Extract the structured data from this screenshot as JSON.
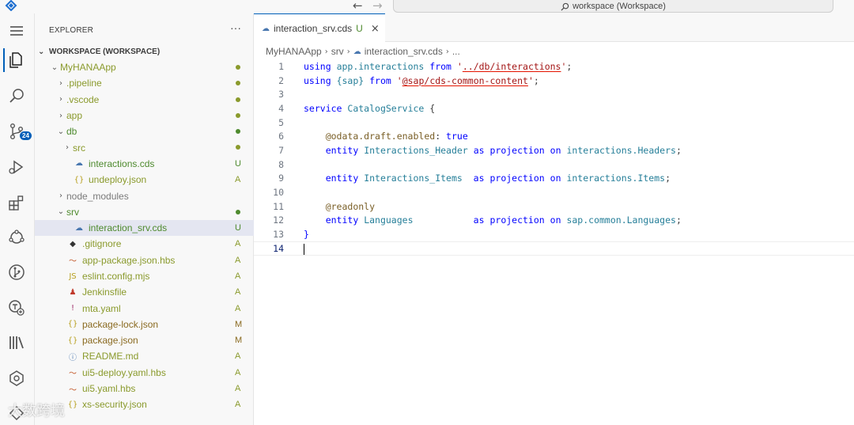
{
  "titlebar": {
    "back_glyph": "←",
    "forward_glyph": "→",
    "search_icon": "search-icon",
    "command_center": "workspace (Workspace)"
  },
  "activity_bar": {
    "icons": [
      "menu-icon",
      "explorer-icon",
      "search-icon",
      "source-control-icon",
      "run-debug-icon",
      "extensions-icon",
      "cloud-icon",
      "git-graph-icon",
      "deploy-icon",
      "library-icon",
      "bug-icon",
      "remote-icon"
    ],
    "source_control_badge": "24"
  },
  "explorer": {
    "title": "EXPLORER",
    "more": "···",
    "workspace_label": "WORKSPACE (WORKSPACE)",
    "items": [
      {
        "label": "MyHANAApp",
        "indent": 1,
        "chev": "⌄",
        "icon": "",
        "status": "dot",
        "color": "olive"
      },
      {
        "label": ".pipeline",
        "indent": 2,
        "chev": "›",
        "icon": "",
        "status": "dot",
        "color": "olive"
      },
      {
        "label": ".vscode",
        "indent": 2,
        "chev": "›",
        "icon": "",
        "status": "dot",
        "color": "olive"
      },
      {
        "label": "app",
        "indent": 2,
        "chev": "›",
        "icon": "",
        "status": "dot",
        "color": "olive"
      },
      {
        "label": "db",
        "indent": 2,
        "chev": "⌄",
        "icon": "",
        "status": "dot",
        "color": "green"
      },
      {
        "label": "src",
        "indent": 3,
        "chev": "›",
        "icon": "",
        "status": "dot",
        "color": "olive"
      },
      {
        "label": "interactions.cds",
        "indent": 3,
        "chev": "",
        "icon": "☁",
        "status": "U",
        "color": "green"
      },
      {
        "label": "undeploy.json",
        "indent": 3,
        "chev": "",
        "icon": "{}",
        "status": "A",
        "color": "olive"
      },
      {
        "label": "node_modules",
        "indent": 2,
        "chev": "›",
        "icon": "",
        "status": "",
        "color": "grey"
      },
      {
        "label": "srv",
        "indent": 2,
        "chev": "⌄",
        "icon": "",
        "status": "dot",
        "color": "green"
      },
      {
        "label": "interaction_srv.cds",
        "indent": 3,
        "chev": "",
        "icon": "☁",
        "status": "U",
        "color": "green",
        "selected": true
      },
      {
        "label": ".gitignore",
        "indent": 2,
        "chev": "",
        "icon": "◆",
        "status": "A",
        "color": "olive"
      },
      {
        "label": "app-package.json.hbs",
        "indent": 2,
        "chev": "",
        "icon": "〜",
        "status": "A",
        "color": "olive"
      },
      {
        "label": "eslint.config.mjs",
        "indent": 2,
        "chev": "",
        "icon": "JS",
        "status": "A",
        "color": "olive"
      },
      {
        "label": "Jenkinsfile",
        "indent": 2,
        "chev": "",
        "icon": "♟",
        "status": "A",
        "color": "olive"
      },
      {
        "label": "mta.yaml",
        "indent": 2,
        "chev": "",
        "icon": "!",
        "status": "A",
        "color": "olive"
      },
      {
        "label": "package-lock.json",
        "indent": 2,
        "chev": "",
        "icon": "{}",
        "status": "M",
        "color": "brown"
      },
      {
        "label": "package.json",
        "indent": 2,
        "chev": "",
        "icon": "{}",
        "status": "M",
        "color": "brown"
      },
      {
        "label": "README.md",
        "indent": 2,
        "chev": "",
        "icon": "ⓘ",
        "status": "A",
        "color": "olive"
      },
      {
        "label": "ui5-deploy.yaml.hbs",
        "indent": 2,
        "chev": "",
        "icon": "〜",
        "status": "A",
        "color": "olive"
      },
      {
        "label": "ui5.yaml.hbs",
        "indent": 2,
        "chev": "",
        "icon": "〜",
        "status": "A",
        "color": "olive"
      },
      {
        "label": "xs-security.json",
        "indent": 2,
        "chev": "",
        "icon": "{}",
        "status": "A",
        "color": "olive"
      }
    ]
  },
  "editor": {
    "tab": {
      "label": "interaction_srv.cds",
      "modified": "U",
      "close": "×"
    },
    "breadcrumb": [
      "MyHANAApp",
      "srv",
      "interaction_srv.cds",
      "..."
    ],
    "lines": [
      {
        "n": "1",
        "html": "<span class='kw'>using</span> <span class='ident'>app.interactions</span> <span class='kw'>from</span> <span class='str'>'<span class=\"squig\">../db/interactions</span>'</span>;"
      },
      {
        "n": "2",
        "html": "<span class='kw'>using</span> <span class='ident'>{sap}</span> <span class='kw'>from</span> <span class='str'>'<span class=\"squig\">@sap/cds-common-content</span>'</span>;"
      },
      {
        "n": "3",
        "html": ""
      },
      {
        "n": "4",
        "html": "<span class='kw'>service</span> <span class='ident'>CatalogService</span> {"
      },
      {
        "n": "5",
        "html": ""
      },
      {
        "n": "6",
        "html": "    <span class='anno'>@odata.draft.enabled</span>: <span class='kw'>true</span>"
      },
      {
        "n": "7",
        "html": "    <span class='kw'>entity</span> <span class='ident'>Interactions_Header</span> <span class='kw'>as</span> <span class='kw'>projection</span> <span class='kw'>on</span> <span class='ident'>interactions.Headers</span>;"
      },
      {
        "n": "8",
        "html": ""
      },
      {
        "n": "9",
        "html": "    <span class='kw'>entity</span> <span class='ident'>Interactions_Items</span>  <span class='kw'>as</span> <span class='kw'>projection</span> <span class='kw'>on</span> <span class='ident'>interactions.Items</span>;"
      },
      {
        "n": "10",
        "html": ""
      },
      {
        "n": "11",
        "html": "    <span class='anno'>@readonly</span>"
      },
      {
        "n": "12",
        "html": "    <span class='kw'>entity</span> <span class='ident'>Languages</span>           <span class='kw'>as</span> <span class='kw'>projection</span> <span class='kw'>on</span> <span class='ident'>sap.common.Languages</span>;"
      },
      {
        "n": "13",
        "html": "<span class='kw'>}</span>"
      },
      {
        "n": "14",
        "html": ""
      }
    ],
    "current_line": "14"
  },
  "watermark": "大数跨境"
}
